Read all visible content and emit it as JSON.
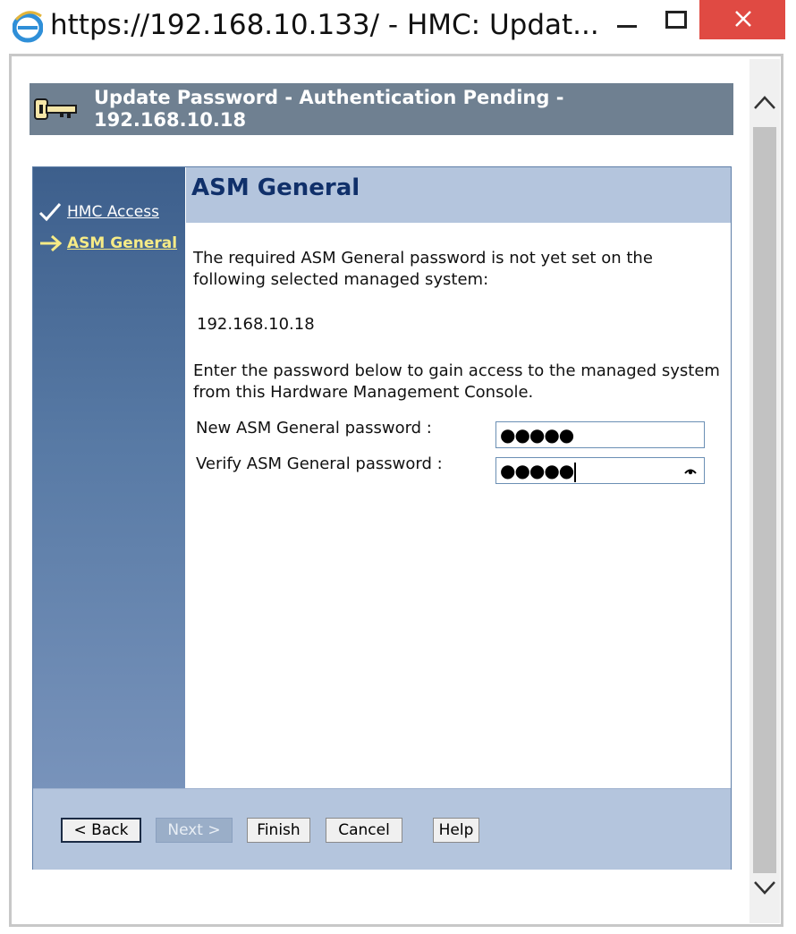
{
  "window": {
    "title": "https://192.168.10.133/ - HMC: Updat..."
  },
  "banner": {
    "title": "Update Password - Authentication Pending - 192.168.10.18",
    "icon": "key-icon"
  },
  "nav": {
    "items": [
      {
        "label": "HMC Access",
        "state": "done",
        "icon": "checkmark-icon"
      },
      {
        "label": "ASM General",
        "state": "current",
        "icon": "arrow-right-icon"
      }
    ]
  },
  "content": {
    "title": "ASM General",
    "intro": "The required ASM General password is not yet set on the following selected managed system:",
    "system_name": "192.168.10.18",
    "instructions": "Enter the password below to gain access to the managed system from this Hardware Management Console.",
    "new_password_label": "New ASM General password :",
    "new_password_value": "●●●●●",
    "verify_password_label": "Verify ASM General password :",
    "verify_password_value": "●●●●●"
  },
  "buttons": {
    "back": "< Back",
    "next": "Next >",
    "finish": "Finish",
    "cancel": "Cancel",
    "help": "Help"
  },
  "colors": {
    "banner": "#6f8091",
    "nav_top": "#3d5f8c",
    "header_band": "#b4c5dd",
    "title_text": "#10306a",
    "current_link": "#f6eb86",
    "close_button": "#e04a43"
  }
}
